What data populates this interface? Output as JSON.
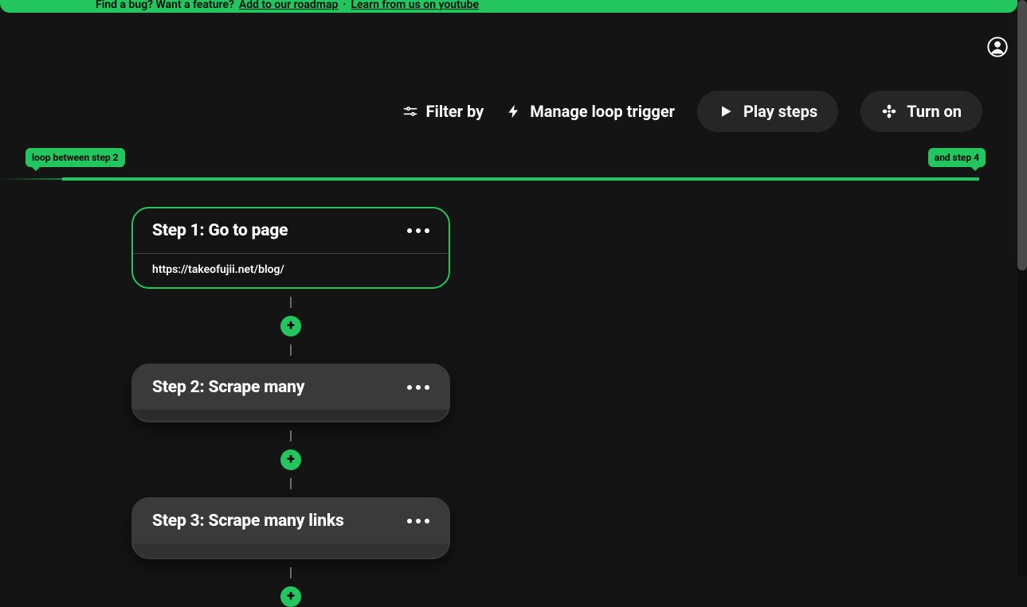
{
  "colors": {
    "accent": "#22c55e"
  },
  "announcement": {
    "prefix": "Find a bug? Want a feature?",
    "link1": "Add to our roadmap",
    "link2": "Learn from us on youtube"
  },
  "toolbar": {
    "filter_label": "Filter by",
    "manage_loop_label": "Manage loop trigger",
    "play_label": "Play steps",
    "turn_on_label": "Turn on"
  },
  "loop": {
    "start_label": "loop between step 2",
    "end_label": "and step 4"
  },
  "steps": [
    {
      "title": "Step 1: Go to page",
      "subtitle": "https://takeofujii.net/blog/",
      "variant": "outlined"
    },
    {
      "title": "Step 2: Scrape many",
      "variant": "filled"
    },
    {
      "title": "Step 3: Scrape many links",
      "variant": "filled"
    }
  ],
  "icons": {
    "add": "+"
  }
}
